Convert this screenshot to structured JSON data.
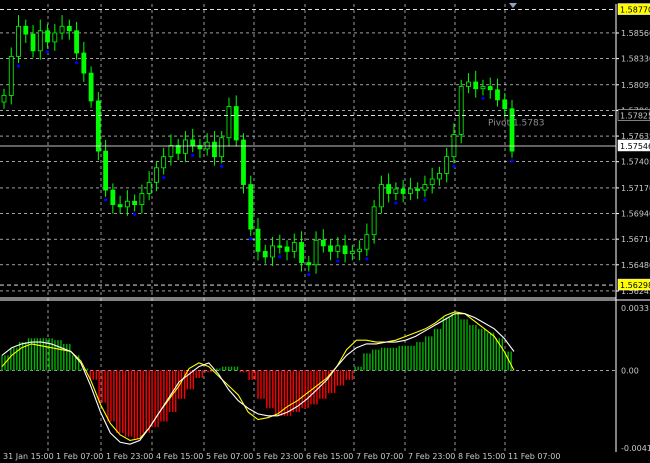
{
  "chart_data": [
    {
      "type": "candlestick",
      "price_ticks": [
        "1.58560",
        "1.58330",
        "1.58095",
        "1.57865",
        "1.57635",
        "1.57405",
        "1.57170",
        "1.56940",
        "1.56710",
        "1.56480",
        "1.56245"
      ],
      "ylim": [
        1.562,
        1.5882
      ],
      "markers": [
        {
          "label": "1.58770",
          "value": 1.5877,
          "bg": "#ffff00",
          "fg": "#000000",
          "line": "dashed"
        },
        {
          "label": "1.57825",
          "value": 1.5782,
          "bg": "#000000",
          "fg": "#c8c8c8",
          "line": "dashed"
        },
        {
          "label": "1.57546",
          "value": 1.57546,
          "bg": "#ffffff",
          "fg": "#000000",
          "line": "solid"
        },
        {
          "label": "1.56298",
          "value": 1.56298,
          "bg": "#ffff00",
          "fg": "#000000",
          "line": "dashed"
        }
      ],
      "pivot_label": "Pivot 1.5783",
      "series": [
        {
          "name": "close",
          "values": [
            1.58,
            1.5835,
            1.5862,
            1.5855,
            1.584,
            1.5858,
            1.5848,
            1.5856,
            1.5862,
            1.5858,
            1.5838,
            1.582,
            1.5795,
            1.575,
            1.5715,
            1.5702,
            1.57,
            1.5705,
            1.5702,
            1.5712,
            1.5722,
            1.5735,
            1.5745,
            1.5755,
            1.5748,
            1.576,
            1.5755,
            1.5752,
            1.5758,
            1.5745,
            1.5762,
            1.579,
            1.576,
            1.572,
            1.568,
            1.566,
            1.5655,
            1.5665,
            1.5664,
            1.566,
            1.5668,
            1.565,
            1.5648,
            1.567,
            1.5665,
            1.566,
            1.5665,
            1.5658,
            1.566,
            1.5662,
            1.5675,
            1.57,
            1.572,
            1.5712,
            1.5716,
            1.5712,
            1.5716,
            1.5715,
            1.572,
            1.5725,
            1.573,
            1.5745,
            1.5765,
            1.5808,
            1.5812,
            1.5806,
            1.5808,
            1.5805,
            1.5796,
            1.5788,
            1.575
          ]
        }
      ],
      "colors": {
        "up": "#00ff00",
        "down": "#00ff00",
        "wick": "#00ff00",
        "fractal": "#0000ff",
        "grid": "#ffffff",
        "ma": "#ffffff"
      }
    },
    {
      "type": "bar",
      "ylim": [
        -0.0041,
        0.0033
      ],
      "y_ticks": [
        "0.0033",
        "0.00",
        "-0.0041"
      ],
      "series": [
        {
          "name": "histogram",
          "values": [
            0.0008,
            0.0012,
            0.0015,
            0.0017,
            0.0017,
            0.0017,
            0.0016,
            0.0014,
            0.0008,
            0.0001,
            -0.0005,
            -0.0017,
            -0.0027,
            -0.0033,
            -0.0035,
            -0.0036,
            -0.0033,
            -0.003,
            -0.0027,
            -0.0022,
            -0.0015,
            -0.001,
            -0.0004,
            -0.0001,
            0.0001,
            0.0002,
            0.0002,
            -0.0001,
            -0.0005,
            -0.0015,
            -0.002,
            -0.0024,
            -0.0024,
            -0.0022,
            -0.002,
            -0.0018,
            -0.0015,
            -0.0012,
            -0.0008,
            -0.0005,
            0.0002,
            0.0009,
            0.0011,
            0.0012,
            0.0012,
            0.0013,
            0.0013,
            0.0015,
            0.0018,
            0.0022,
            0.0028,
            0.003,
            0.0027,
            0.0024,
            0.0022,
            0.002,
            0.0017,
            0.001
          ]
        },
        {
          "name": "signal_yellow",
          "values": [
            0.0002,
            0.0008,
            0.0012,
            0.0014,
            0.0013,
            0.0012,
            0.0011,
            0.001,
            0.0005,
            -0.0005,
            -0.0018,
            -0.0028,
            -0.0034,
            -0.0037,
            -0.0036,
            -0.003,
            -0.0022,
            -0.0015,
            -0.0008,
            0.0001,
            0.0004,
            0.0002,
            -0.0003,
            -0.0008,
            -0.0013,
            -0.0022,
            -0.0026,
            -0.0025,
            -0.0023,
            -0.0019,
            -0.0016,
            -0.0012,
            -0.0008,
            -0.0004,
            0.0002,
            0.0011,
            0.0016,
            0.0016,
            0.0015,
            0.0015,
            0.0016,
            0.0018,
            0.002,
            0.0022,
            0.0025,
            0.0029,
            0.0031,
            0.003,
            0.0026,
            0.0022,
            0.0018,
            0.001,
            0.0
          ]
        },
        {
          "name": "signal_white",
          "values": [
            0.0008,
            0.0012,
            0.0014,
            0.0015,
            0.0015,
            0.0014,
            0.0012,
            0.001,
            0.0004,
            -0.0008,
            -0.0022,
            -0.0033,
            -0.0038,
            -0.0039,
            -0.0037,
            -0.003,
            -0.0022,
            -0.0014,
            -0.0006,
            -0.0002,
            0.0002,
            0.0004,
            -0.0002,
            -0.001,
            -0.0016,
            -0.002,
            -0.0023,
            -0.0024,
            -0.0024,
            -0.0022,
            -0.0019,
            -0.0015,
            -0.001,
            -0.0005,
            0.0002,
            0.0008,
            0.0012,
            0.0014,
            0.0014,
            0.0015,
            0.0015,
            0.0016,
            0.0018,
            0.0021,
            0.0024,
            0.0027,
            0.003,
            0.003,
            0.0028,
            0.0025,
            0.0022,
            0.0017,
            0.001
          ]
        }
      ],
      "colors": {
        "positive": "#00b400",
        "negative": "#ff0000",
        "yellow": "#ffff00",
        "white": "#ffffff"
      }
    }
  ],
  "x_ticks": [
    "31 Jan 15:00",
    "1 Feb 07:00",
    "1 Feb 23:00",
    "4 Feb 15:00",
    "5 Feb 07:00",
    "5 Feb 23:00",
    "6 Feb 15:00",
    "7 Feb 07:00",
    "7 Feb 23:00",
    "8 Feb 15:00",
    "11 Feb 07:00"
  ]
}
